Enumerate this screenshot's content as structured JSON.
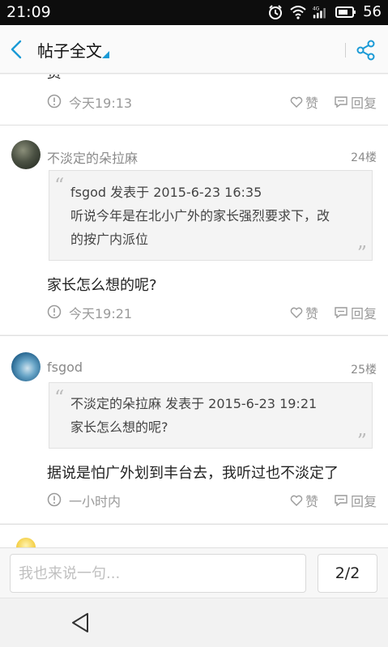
{
  "status_bar": {
    "time": "21:09",
    "battery": "56",
    "network": "4G",
    "icons": [
      "alarm-icon",
      "wifi-icon",
      "signal-icon",
      "battery-icon"
    ]
  },
  "header": {
    "title": "帖子全文",
    "accent_color": "#1a9ad6",
    "icons": [
      "back-arrow-icon",
      "share-icon"
    ]
  },
  "posts": [
    {
      "text_partial": "赘",
      "time": "今天19:13",
      "like_label": "赞",
      "reply_label": "回复"
    },
    {
      "username": "不淡定的朵拉麻",
      "floor": "24楼",
      "quote": {
        "line1": "fsgod 发表于 2015-6-23 16:35",
        "line2": "听说今年是在北小广外的家长强烈要求下，改",
        "line3": "的按广内派位"
      },
      "text": "家长怎么想的呢?",
      "time": "今天19:21",
      "like_label": "赞",
      "reply_label": "回复"
    },
    {
      "username": "fsgod",
      "floor": "25楼",
      "quote": {
        "line1": "不淡定的朵拉麻 发表于 2015-6-23 19:21",
        "line2": "家长怎么想的呢?"
      },
      "text": "据说是怕广外划到丰台去，我听过也不淡定了",
      "time": "一小时内",
      "like_label": "赞",
      "reply_label": "回复"
    }
  ],
  "composer": {
    "placeholder": "我也来说一句...",
    "page_indicator": "2/2"
  },
  "nav": {
    "icons": [
      "nav-back-icon"
    ]
  }
}
